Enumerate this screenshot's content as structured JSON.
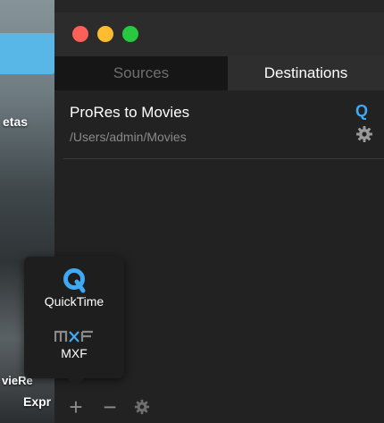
{
  "desktop": {
    "labels": [
      {
        "text": "etas"
      },
      {
        "text": "vieRe"
      },
      {
        "text": "Expr"
      }
    ]
  },
  "window": {
    "tabs": [
      {
        "label": "Sources",
        "active": false
      },
      {
        "label": "Destinations",
        "active": true
      }
    ],
    "destination": {
      "name": "ProRes to Movies",
      "path": "/Users/admin/Movies",
      "format_icon": "quicktime-icon",
      "format_glyph": "Q"
    },
    "bottom_bar": {
      "add_glyph": "+",
      "remove_glyph": "−",
      "settings_icon": "gear-icon"
    }
  },
  "popover": {
    "items": [
      {
        "label": "QuickTime",
        "icon": "quicktime-icon"
      },
      {
        "label": "MXF",
        "icon": "mxf-logo-icon"
      }
    ]
  },
  "colors": {
    "accent_blue": "#3fa9f5",
    "close": "#fe5f57",
    "minimize": "#febc2e",
    "zoom": "#28c840"
  }
}
